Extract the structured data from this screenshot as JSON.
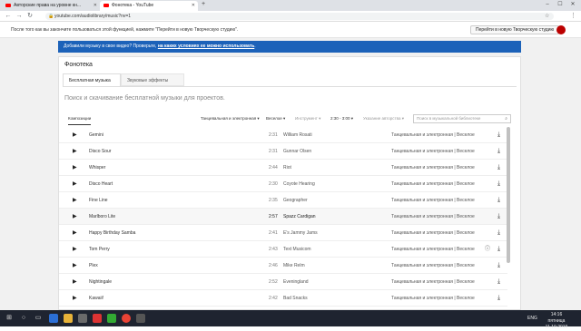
{
  "browser": {
    "tabs": [
      {
        "label": "Авторские права на уровне кн..."
      },
      {
        "label": "Фонотека - YouTube"
      }
    ],
    "url": "youtube.com/audiolibrary/music?nv=1"
  },
  "notice": {
    "text": "После того как вы закончите пользоваться этой функцией, нажмите \"Перейти в новую Творческую студию\".",
    "button": "Перейти в новую Творческую студию"
  },
  "banner": {
    "text": "Добавили музыку в свое видео? Проверьте, ",
    "link": "на каких условиях ее можно использовать",
    "end": "."
  },
  "page": {
    "title": "Фонотека",
    "tabs": [
      "Бесплатная музыка",
      "Звуковые эффекты"
    ],
    "heading": "Поиск и скачивание бесплатной музыки для проектов."
  },
  "filters": {
    "compositions": "Композиции",
    "genre": "Танцевальная и электронная ▾",
    "mood": "Веселое ▾",
    "instrument": "Инструмент ▾",
    "duration": "2:30 - 3:00 ▾",
    "attribution": "Указание авторства ▾",
    "search_placeholder": "Поиск в музыкальной библиотеке"
  },
  "tracks": [
    {
      "title": "Gemini",
      "duration": "2:31",
      "artist": "William Rosati",
      "genre": "Танцевальная и электронная | Веселое"
    },
    {
      "title": "Disco Sour",
      "duration": "2:31",
      "artist": "Gunnar Olsen",
      "genre": "Танцевальная и электронная | Веселое"
    },
    {
      "title": "Whisper",
      "duration": "2:44",
      "artist": "Riot",
      "genre": "Танцевальная и электронная | Веселое"
    },
    {
      "title": "Disco Heart",
      "duration": "2:30",
      "artist": "Coyote Hearing",
      "genre": "Танцевальная и электронная | Веселое"
    },
    {
      "title": "Fine Line",
      "duration": "2:35",
      "artist": "Geographer",
      "genre": "Танцевальная и электронная | Веселое"
    },
    {
      "title": "Marlboro Lite",
      "duration": "2:57",
      "artist": "Spazz Cardigan",
      "genre": "Танцевальная и электронная | Веселое"
    },
    {
      "title": "Happy Birthday Samba",
      "duration": "2:41",
      "artist": "E's Jammy Jams",
      "genre": "Танцевальная и электронная | Веселое"
    },
    {
      "title": "Tom Perry",
      "duration": "2:43",
      "artist": "Text Musicom",
      "genre": "Танцевальная и электронная | Веселое"
    },
    {
      "title": "Plex",
      "duration": "2:46",
      "artist": "Mike Relm",
      "genre": "Танцевальная и электронная | Веселое"
    },
    {
      "title": "Nightingale",
      "duration": "2:52",
      "artist": "Eveningland",
      "genre": "Танцевальная и электронная | Веселое"
    },
    {
      "title": "Kawaii!",
      "duration": "2:42",
      "artist": "Bad Snacks",
      "genre": "Танцевальная и электронная | Веселое"
    }
  ],
  "taskbar": {
    "lang": "ENG",
    "time": "14:16",
    "day": "пятница",
    "date": "11.10.2019"
  }
}
